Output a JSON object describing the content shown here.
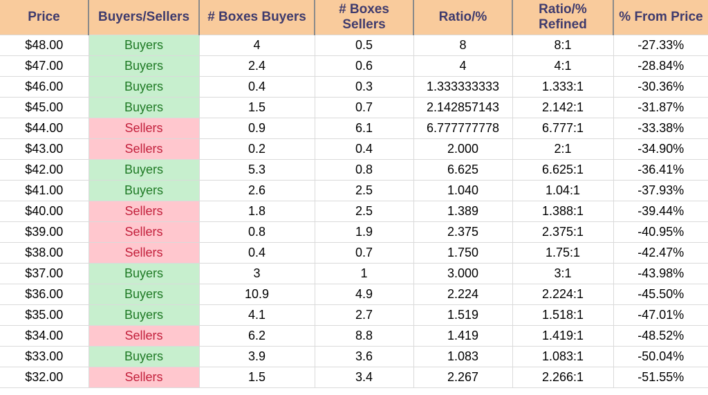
{
  "table": {
    "headers": [
      "Price",
      "Buyers/Sellers",
      "# Boxes Buyers",
      "# Boxes Sellers",
      "Ratio/%",
      "Ratio/% Refined",
      "% From Price"
    ],
    "colors": {
      "header_bg": "#F9CB9C",
      "header_text": "#3F3B6D",
      "buyers_bg": "#C7EFCE",
      "buyers_text": "#1F7A25",
      "sellers_bg": "#FFC7CE",
      "sellers_text": "#C3203C",
      "grid_line": "#DADADA",
      "header_divider": "#8A8A8A",
      "cell_text": "#000000"
    },
    "rows": [
      {
        "price": "$48.00",
        "side": "Buyers",
        "boxes_buyers": "4",
        "boxes_sellers": "0.5",
        "ratio_pct": "8",
        "ratio_refined": "8:1",
        "pct_from_price": "-27.33%"
      },
      {
        "price": "$47.00",
        "side": "Buyers",
        "boxes_buyers": "2.4",
        "boxes_sellers": "0.6",
        "ratio_pct": "4",
        "ratio_refined": "4:1",
        "pct_from_price": "-28.84%"
      },
      {
        "price": "$46.00",
        "side": "Buyers",
        "boxes_buyers": "0.4",
        "boxes_sellers": "0.3",
        "ratio_pct": "1.333333333",
        "ratio_refined": "1.333:1",
        "pct_from_price": "-30.36%"
      },
      {
        "price": "$45.00",
        "side": "Buyers",
        "boxes_buyers": "1.5",
        "boxes_sellers": "0.7",
        "ratio_pct": "2.142857143",
        "ratio_refined": "2.142:1",
        "pct_from_price": "-31.87%"
      },
      {
        "price": "$44.00",
        "side": "Sellers",
        "boxes_buyers": "0.9",
        "boxes_sellers": "6.1",
        "ratio_pct": "6.777777778",
        "ratio_refined": "6.777:1",
        "pct_from_price": "-33.38%"
      },
      {
        "price": "$43.00",
        "side": "Sellers",
        "boxes_buyers": "0.2",
        "boxes_sellers": "0.4",
        "ratio_pct": "2.000",
        "ratio_refined": "2:1",
        "pct_from_price": "-34.90%"
      },
      {
        "price": "$42.00",
        "side": "Buyers",
        "boxes_buyers": "5.3",
        "boxes_sellers": "0.8",
        "ratio_pct": "6.625",
        "ratio_refined": "6.625:1",
        "pct_from_price": "-36.41%"
      },
      {
        "price": "$41.00",
        "side": "Buyers",
        "boxes_buyers": "2.6",
        "boxes_sellers": "2.5",
        "ratio_pct": "1.040",
        "ratio_refined": "1.04:1",
        "pct_from_price": "-37.93%"
      },
      {
        "price": "$40.00",
        "side": "Sellers",
        "boxes_buyers": "1.8",
        "boxes_sellers": "2.5",
        "ratio_pct": "1.389",
        "ratio_refined": "1.388:1",
        "pct_from_price": "-39.44%"
      },
      {
        "price": "$39.00",
        "side": "Sellers",
        "boxes_buyers": "0.8",
        "boxes_sellers": "1.9",
        "ratio_pct": "2.375",
        "ratio_refined": "2.375:1",
        "pct_from_price": "-40.95%"
      },
      {
        "price": "$38.00",
        "side": "Sellers",
        "boxes_buyers": "0.4",
        "boxes_sellers": "0.7",
        "ratio_pct": "1.750",
        "ratio_refined": "1.75:1",
        "pct_from_price": "-42.47%"
      },
      {
        "price": "$37.00",
        "side": "Buyers",
        "boxes_buyers": "3",
        "boxes_sellers": "1",
        "ratio_pct": "3.000",
        "ratio_refined": "3:1",
        "pct_from_price": "-43.98%"
      },
      {
        "price": "$36.00",
        "side": "Buyers",
        "boxes_buyers": "10.9",
        "boxes_sellers": "4.9",
        "ratio_pct": "2.224",
        "ratio_refined": "2.224:1",
        "pct_from_price": "-45.50%"
      },
      {
        "price": "$35.00",
        "side": "Buyers",
        "boxes_buyers": "4.1",
        "boxes_sellers": "2.7",
        "ratio_pct": "1.519",
        "ratio_refined": "1.518:1",
        "pct_from_price": "-47.01%"
      },
      {
        "price": "$34.00",
        "side": "Sellers",
        "boxes_buyers": "6.2",
        "boxes_sellers": "8.8",
        "ratio_pct": "1.419",
        "ratio_refined": "1.419:1",
        "pct_from_price": "-48.52%"
      },
      {
        "price": "$33.00",
        "side": "Buyers",
        "boxes_buyers": "3.9",
        "boxes_sellers": "3.6",
        "ratio_pct": "1.083",
        "ratio_refined": "1.083:1",
        "pct_from_price": "-50.04%"
      },
      {
        "price": "$32.00",
        "side": "Sellers",
        "boxes_buyers": "1.5",
        "boxes_sellers": "3.4",
        "ratio_pct": "2.267",
        "ratio_refined": "2.266:1",
        "pct_from_price": "-51.55%"
      }
    ]
  }
}
